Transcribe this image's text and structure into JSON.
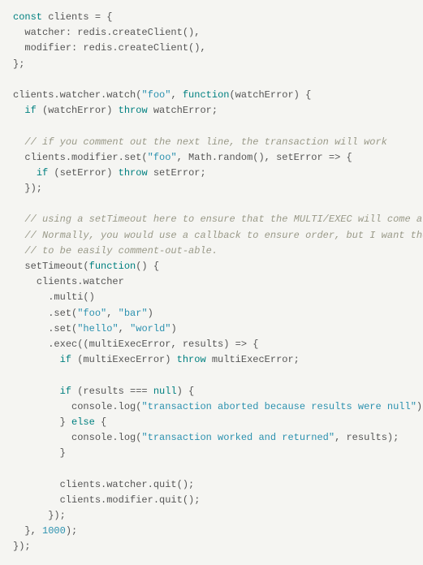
{
  "code_lines": [
    {
      "indent": 0,
      "spans": [
        {
          "t": "const ",
          "c": "kw"
        },
        {
          "t": "clients = {",
          "c": "ident"
        }
      ]
    },
    {
      "indent": 1,
      "spans": [
        {
          "t": "watcher: redis.createClient(),",
          "c": "ident"
        }
      ]
    },
    {
      "indent": 1,
      "spans": [
        {
          "t": "modifier: redis.createClient(),",
          "c": "ident"
        }
      ]
    },
    {
      "indent": 0,
      "spans": [
        {
          "t": "};",
          "c": "ident"
        }
      ]
    },
    {
      "indent": 0,
      "spans": []
    },
    {
      "indent": 0,
      "spans": [
        {
          "t": "clients.watcher.watch(",
          "c": "ident"
        },
        {
          "t": "\"foo\"",
          "c": "str"
        },
        {
          "t": ", ",
          "c": "ident"
        },
        {
          "t": "function",
          "c": "kw"
        },
        {
          "t": "(watchError) {",
          "c": "ident"
        }
      ]
    },
    {
      "indent": 1,
      "spans": [
        {
          "t": "if ",
          "c": "kw"
        },
        {
          "t": "(watchError) ",
          "c": "ident"
        },
        {
          "t": "throw ",
          "c": "kw"
        },
        {
          "t": "watchError;",
          "c": "ident"
        }
      ]
    },
    {
      "indent": 0,
      "spans": []
    },
    {
      "indent": 1,
      "spans": [
        {
          "t": "// if you comment out the next line, the transaction will work",
          "c": "comm"
        }
      ]
    },
    {
      "indent": 1,
      "spans": [
        {
          "t": "clients.modifier.set(",
          "c": "ident"
        },
        {
          "t": "\"foo\"",
          "c": "str"
        },
        {
          "t": ", Math.random(), setError => {",
          "c": "ident"
        }
      ]
    },
    {
      "indent": 2,
      "spans": [
        {
          "t": "if ",
          "c": "kw"
        },
        {
          "t": "(setError) ",
          "c": "ident"
        },
        {
          "t": "throw ",
          "c": "kw"
        },
        {
          "t": "setError;",
          "c": "ident"
        }
      ]
    },
    {
      "indent": 1,
      "spans": [
        {
          "t": "});",
          "c": "ident"
        }
      ]
    },
    {
      "indent": 0,
      "spans": []
    },
    {
      "indent": 1,
      "spans": [
        {
          "t": "// using a setTimeout here to ensure that the MULTI/EXEC will come after the SET.",
          "c": "comm"
        }
      ]
    },
    {
      "indent": 1,
      "spans": [
        {
          "t": "// Normally, you would use a callback to ensure order, but I want the above SET command",
          "c": "comm"
        }
      ]
    },
    {
      "indent": 1,
      "spans": [
        {
          "t": "// to be easily comment-out-able.",
          "c": "comm"
        }
      ]
    },
    {
      "indent": 1,
      "spans": [
        {
          "t": "setTimeout(",
          "c": "ident"
        },
        {
          "t": "function",
          "c": "kw"
        },
        {
          "t": "() {",
          "c": "ident"
        }
      ]
    },
    {
      "indent": 2,
      "spans": [
        {
          "t": "clients.watcher",
          "c": "ident"
        }
      ]
    },
    {
      "indent": 3,
      "spans": [
        {
          "t": ".multi()",
          "c": "ident"
        }
      ]
    },
    {
      "indent": 3,
      "spans": [
        {
          "t": ".set(",
          "c": "ident"
        },
        {
          "t": "\"foo\"",
          "c": "str"
        },
        {
          "t": ", ",
          "c": "ident"
        },
        {
          "t": "\"bar\"",
          "c": "str"
        },
        {
          "t": ")",
          "c": "ident"
        }
      ]
    },
    {
      "indent": 3,
      "spans": [
        {
          "t": ".set(",
          "c": "ident"
        },
        {
          "t": "\"hello\"",
          "c": "str"
        },
        {
          "t": ", ",
          "c": "ident"
        },
        {
          "t": "\"world\"",
          "c": "str"
        },
        {
          "t": ")",
          "c": "ident"
        }
      ]
    },
    {
      "indent": 3,
      "spans": [
        {
          "t": ".exec((multiExecError, results) => {",
          "c": "ident"
        }
      ]
    },
    {
      "indent": 4,
      "spans": [
        {
          "t": "if ",
          "c": "kw"
        },
        {
          "t": "(multiExecError) ",
          "c": "ident"
        },
        {
          "t": "throw ",
          "c": "kw"
        },
        {
          "t": "multiExecError;",
          "c": "ident"
        }
      ]
    },
    {
      "indent": 0,
      "spans": []
    },
    {
      "indent": 4,
      "spans": [
        {
          "t": "if ",
          "c": "kw"
        },
        {
          "t": "(results === ",
          "c": "ident"
        },
        {
          "t": "null",
          "c": "kw"
        },
        {
          "t": ") {",
          "c": "ident"
        }
      ]
    },
    {
      "indent": 5,
      "spans": [
        {
          "t": "console.log(",
          "c": "ident"
        },
        {
          "t": "\"transaction aborted because results were null\"",
          "c": "str"
        },
        {
          "t": ");",
          "c": "ident"
        }
      ]
    },
    {
      "indent": 4,
      "spans": [
        {
          "t": "} ",
          "c": "ident"
        },
        {
          "t": "else ",
          "c": "kw"
        },
        {
          "t": "{",
          "c": "ident"
        }
      ]
    },
    {
      "indent": 5,
      "spans": [
        {
          "t": "console.log(",
          "c": "ident"
        },
        {
          "t": "\"transaction worked and returned\"",
          "c": "str"
        },
        {
          "t": ", results);",
          "c": "ident"
        }
      ]
    },
    {
      "indent": 4,
      "spans": [
        {
          "t": "}",
          "c": "ident"
        }
      ]
    },
    {
      "indent": 0,
      "spans": []
    },
    {
      "indent": 4,
      "spans": [
        {
          "t": "clients.watcher.quit();",
          "c": "ident"
        }
      ]
    },
    {
      "indent": 4,
      "spans": [
        {
          "t": "clients.modifier.quit();",
          "c": "ident"
        }
      ]
    },
    {
      "indent": 3,
      "spans": [
        {
          "t": "});",
          "c": "ident"
        }
      ]
    },
    {
      "indent": 1,
      "spans": [
        {
          "t": "}, ",
          "c": "ident"
        },
        {
          "t": "1000",
          "c": "num"
        },
        {
          "t": ");",
          "c": "ident"
        }
      ]
    },
    {
      "indent": 0,
      "spans": [
        {
          "t": "});",
          "c": "ident"
        }
      ]
    }
  ],
  "indent_unit": "  "
}
